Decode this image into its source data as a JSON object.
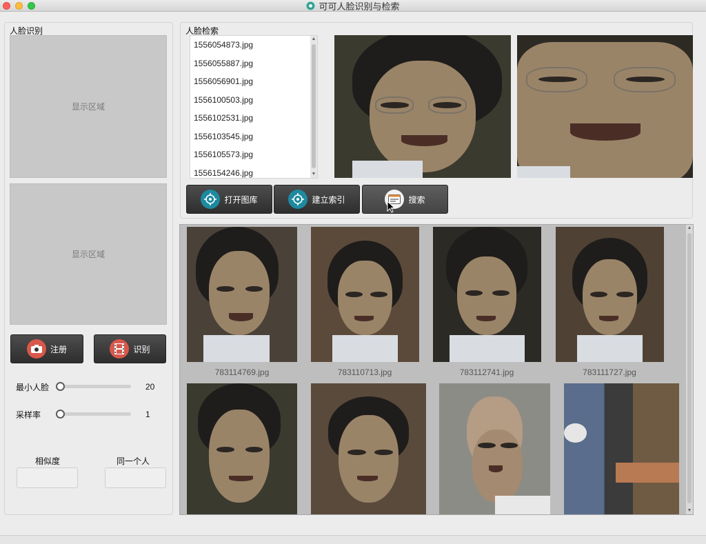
{
  "window": {
    "title": "可可人脸识别与检索"
  },
  "left_panel": {
    "title": "人脸识别",
    "display_top": "显示区域",
    "display_bottom": "显示区域",
    "register_button": "注册",
    "recognize_button": "识别",
    "min_face_label": "最小人脸",
    "min_face_value": "20",
    "min_face_level": 0,
    "sample_rate_label": "采样率",
    "sample_rate_value": "1",
    "sample_rate_level": 0,
    "similarity_label": "相似度",
    "same_person_label": "同一个人",
    "similarity_value": "",
    "same_person_value": ""
  },
  "right_panel": {
    "title": "人脸检索",
    "files": [
      "1556054873.jpg",
      "1556055887.jpg",
      "1556056901.jpg",
      "1556100503.jpg",
      "1556102531.jpg",
      "1556103545.jpg",
      "1556105573.jpg",
      "1556154246.jpg"
    ],
    "open_gallery_button": "打开图库",
    "build_index_button": "建立索引",
    "search_button": "搜索"
  },
  "results": [
    {
      "caption": "783114769.jpg"
    },
    {
      "caption": "783110713.jpg"
    },
    {
      "caption": "783112741.jpg"
    },
    {
      "caption": "783111727.jpg"
    }
  ],
  "icons": {
    "app": "face-app-icon",
    "register": "camera-icon",
    "recognize": "film-icon",
    "open_gallery": "target-icon",
    "build_index": "target-icon",
    "search": "window-search-icon"
  }
}
